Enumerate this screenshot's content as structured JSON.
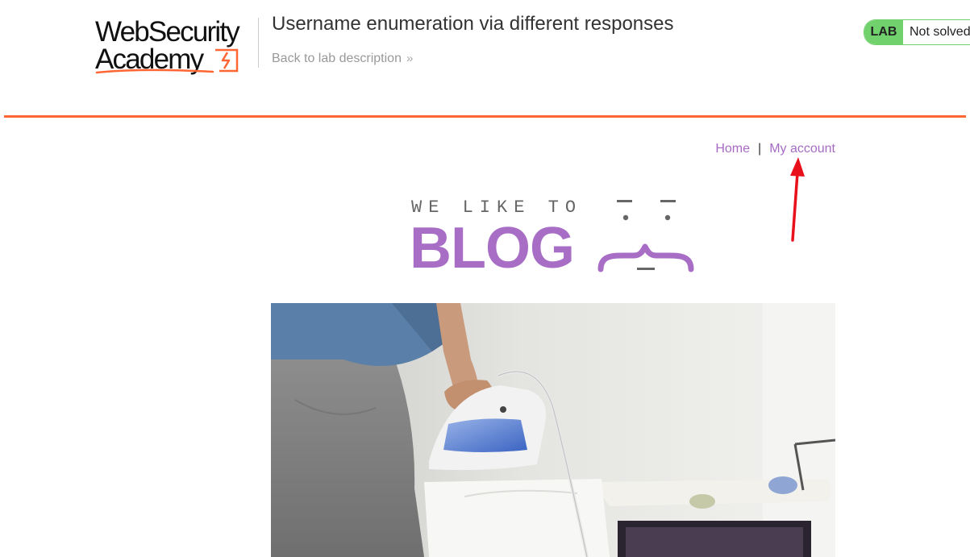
{
  "lab_header": {
    "logo_line1": "WebSecurity",
    "logo_line2": "Academy",
    "title": "Username enumeration via different responses",
    "back_link": "Back to lab description",
    "back_chevron": "»",
    "badge": "LAB",
    "status": "Not solved"
  },
  "nav": {
    "home": "Home",
    "separator": "|",
    "my_account": "My account"
  },
  "blog_logo": {
    "tagline": "WE LIKE TO",
    "word": "BLOG"
  },
  "hero_image": {
    "alt": "Person ironing a white shirt on an ironing board"
  },
  "colors": {
    "accent_orange": "#ff6633",
    "link_purple": "#a66cc4",
    "blog_purple": "#a86ec6",
    "lab_green": "#70d16d",
    "annotation_red": "#e8101a"
  }
}
